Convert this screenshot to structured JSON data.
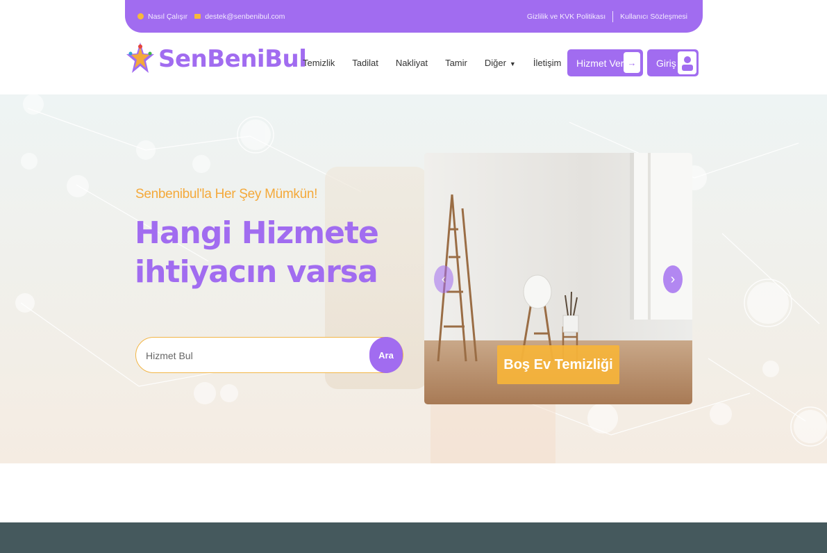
{
  "topbar": {
    "how_it_works": "Nasıl Çalışır",
    "email": "destek@senbenibul.com",
    "privacy": "Gizlilik ve KVK Politikası",
    "terms": "Kullanıcı Sözleşmesi"
  },
  "brand": {
    "name": "SenBeniBul",
    "accent": "#a16cf0",
    "highlight": "#f4a93a"
  },
  "nav": {
    "items": [
      "Temizlik",
      "Tadilat",
      "Nakliyat",
      "Tamir",
      "Diğer",
      "İletişim"
    ]
  },
  "actions": {
    "provide_service": "Hizmet Ver",
    "login": "Giriş"
  },
  "hero": {
    "tagline": "Senbenibul'la Her Şey Mümkün!",
    "headline_line1": "Hangi Hizmete",
    "headline_line2": "ihtiyacın varsa",
    "search_placeholder": "Hizmet Bul",
    "search_button": "Ara"
  },
  "carousel": {
    "caption": "Boş Ev Temizliği",
    "prev_icon": "chevron-left-icon",
    "next_icon": "chevron-right-icon"
  }
}
